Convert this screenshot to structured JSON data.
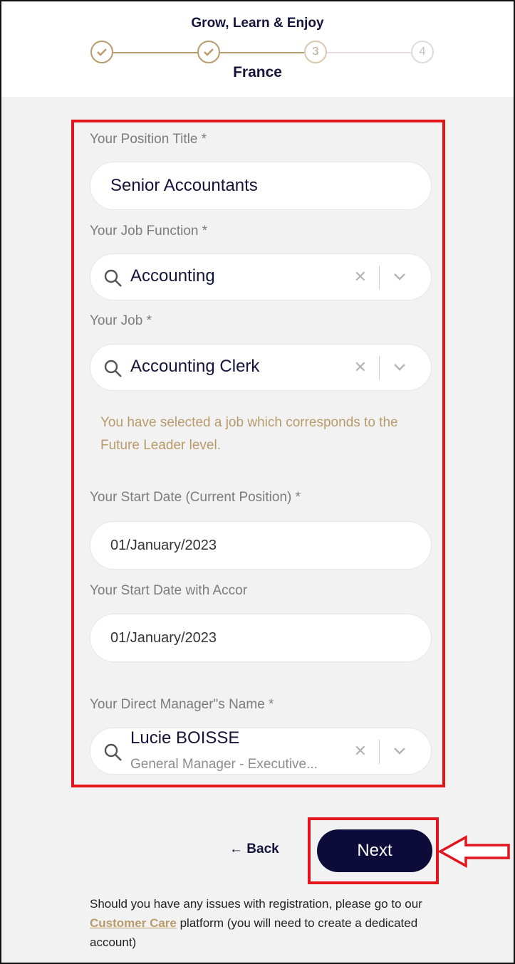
{
  "header": {
    "title": "Grow, Learn & Enjoy",
    "country": "France",
    "steps": [
      {
        "label": "",
        "state": "done"
      },
      {
        "label": "",
        "state": "done"
      },
      {
        "label": "3",
        "state": "current"
      },
      {
        "label": "4",
        "state": "todo"
      }
    ]
  },
  "form": {
    "position_title": {
      "label": "Your Position Title *",
      "value": "Senior Accountants"
    },
    "job_function": {
      "label": "Your Job Function *",
      "value": "Accounting"
    },
    "job": {
      "label": "Your Job *",
      "value": "Accounting Clerk"
    },
    "notice": "You have selected a job which corresponds to the Future Leader level.",
    "start_date_current": {
      "label": "Your Start Date (Current Position) *",
      "value": "01/January/2023"
    },
    "start_date_accor": {
      "label": "Your Start Date with Accor",
      "value": "01/January/2023"
    },
    "manager": {
      "label": "Your Direct Manager\"s Name *",
      "name": "Lucie BOISSE",
      "subtitle": "General Manager - Executive..."
    }
  },
  "nav": {
    "back_label": "← Back",
    "next_label": "Next"
  },
  "footer": {
    "text_before": "Should you have any issues with registration, please go to our ",
    "link_label": "Customer Care",
    "text_after": " platform (you will need to create a dedicated account)"
  },
  "colors": {
    "brand_navy": "#0c0b3a",
    "gold": "#b99a6b",
    "highlight_red": "#e2141c"
  }
}
